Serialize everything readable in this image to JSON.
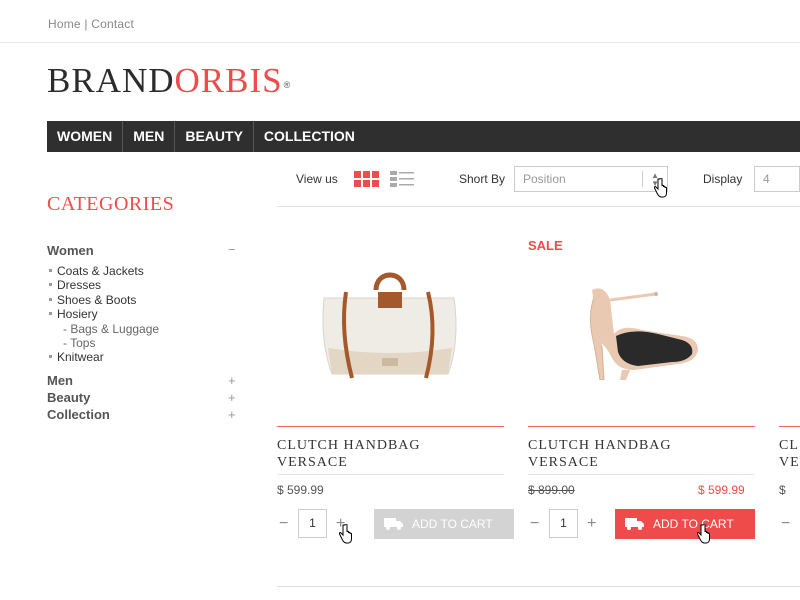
{
  "top_links": {
    "home": "Home",
    "separator": "|",
    "contact": "Contact"
  },
  "logo": {
    "part1": "BRAND",
    "part2": "ORBIS",
    "mark": "®"
  },
  "nav": {
    "items": [
      "WOMEN",
      "MEN",
      "BEAUTY",
      "COLLECTION"
    ]
  },
  "sidebar": {
    "title": "CATEGORIES",
    "groups": [
      {
        "label": "Women",
        "sign": "−",
        "items": [
          "Coats & Jackets",
          "Dresses",
          "Shoes & Boots",
          "Hosiery"
        ],
        "subitems": [
          "- Bags & Luggage",
          "- Tops"
        ],
        "after": "Knitwear"
      },
      {
        "label": "Men",
        "sign": "+"
      },
      {
        "label": "Beauty",
        "sign": "+"
      },
      {
        "label": "Collection",
        "sign": "+"
      }
    ]
  },
  "toolbar": {
    "view_label": "View us",
    "sort_label": "Short By",
    "sort_value": "Position",
    "display_label": "Display",
    "display_value": "4"
  },
  "products": [
    {
      "name_line1": "CLUTCH HANDBAG",
      "name_line2": "VERSACE",
      "price": "$ 599.99",
      "qty": "1",
      "cart_label": "ADD TO CART",
      "sale": ""
    },
    {
      "name_line1": "CLUTCH HANDBAG",
      "name_line2": "VERSACE",
      "old_price": "$ 899.00",
      "price": "$ 599.99",
      "qty": "1",
      "cart_label": "ADD TO CART",
      "sale": "SALE"
    },
    {
      "name_line1": "CL",
      "name_line2": "VE",
      "price": "$",
      "qty_minus": "−"
    }
  ],
  "colors": {
    "accent": "#ef4b4b",
    "nav_bg": "#2f2f2f",
    "cart_disabled": "#d3d3d3"
  }
}
